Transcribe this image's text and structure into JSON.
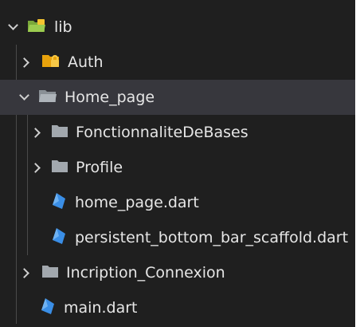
{
  "explorer": {
    "items": [
      {
        "label": "lib",
        "icon": "folder-lib-open-icon",
        "expanded": true
      },
      {
        "label": "Auth",
        "icon": "folder-lock-icon",
        "expanded": false
      },
      {
        "label": "Home_page",
        "icon": "folder-open-icon",
        "expanded": true,
        "selected": true
      },
      {
        "label": "FonctionnaliteDeBases",
        "icon": "folder-icon",
        "expanded": false
      },
      {
        "label": "Profile",
        "icon": "folder-icon",
        "expanded": false
      },
      {
        "label": "home_page.dart",
        "icon": "dart-file-icon"
      },
      {
        "label": "persistent_bottom_bar_scaffold.dart",
        "icon": "dart-file-icon"
      },
      {
        "label": "Incription_Connexion",
        "icon": "folder-icon",
        "expanded": false
      },
      {
        "label": "main.dart",
        "icon": "dart-file-icon"
      }
    ]
  },
  "colors": {
    "background": "#1f1f1f",
    "selected_row": "#37373d",
    "text": "#e6e6e6",
    "folder_gray": "#9aa0a6",
    "folder_lib": "#8bc34a",
    "folder_lib_badge": "#f4c430",
    "folder_auth": "#f0a30a",
    "dart_blue": "#3a8ee6"
  }
}
